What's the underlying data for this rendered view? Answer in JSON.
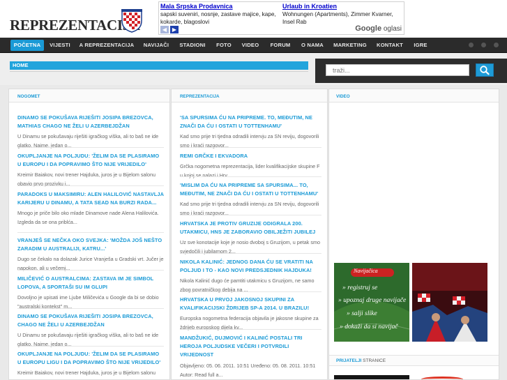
{
  "site": {
    "logo_text": "REPREZENTACIJA"
  },
  "ad": {
    "col1_title": "Mala Srpska Prodavnica",
    "col1_text": "sapski suveniri, nosnje, zastave majice, kape, kokarde, blagoslovi",
    "col2_title": "Urlaub in Kroatien",
    "col2_text": "Wohnungen (Apartments), Zimmer Kvarner, Insel Rab",
    "brand_google": "Google",
    "brand_oglasi": "oglasi"
  },
  "nav": {
    "items": [
      "POČETNA",
      "VIJESTI",
      "A REPREZENTACIJA",
      "NAVIJAČI",
      "STADIONI",
      "FOTO",
      "VIDEO",
      "FORUM",
      "O NAMA",
      "MARKETING",
      "KONTAKT",
      "IGRE"
    ],
    "active_index": 0
  },
  "breadcrumb": {
    "home": "HOME"
  },
  "search": {
    "placeholder": "traži..."
  },
  "columns": {
    "nogomet": {
      "title": "NOGOMET",
      "articles": [
        {
          "title": "DINAMO SE POKUŠAVA RIJEŠITI JOSIPA BREZOVCA, MATHIAS CHAGO NE ŽELI U AZERBEJDŽAN",
          "text": "U Dinamu se pokušavaju riješiti igračkog viška, ali to baš ne ide glatko. Naime, jedan o..."
        },
        {
          "title": "OKUPLJANJE NA POLJUDU: 'ŽELIM DA SE PLASIRAMO U EUROPU I DA POPRAVIMO ŠTO NIJE VRIJEDILO'",
          "text": "Kreimir Baiakov, novi trener Hajduka, juros je u Bijelom salonu obavio prvo prozivku i..."
        },
        {
          "title": "PARADOKS U MAKSIMIRU: ALEN HALILOVIĆ NASTAVLJA KARIJERU U DINAMU, A TATA SEAD NA BURZI RADA...",
          "text": "Mnogo je priče bilo oko mlade Dinamove nade Alena Halilovića. Izgleda da se ona priblća..."
        },
        {
          "title": "VRANJEŠ SE NEČKA OKO SVEJKA: 'MOŽDA JOŠ NEŠTO ZARADIM U AUSTRALIJI, KATRU...'",
          "text": "Dugo se čekalo na dolazak Jurice Vranješa u Gradski vrt. Jučer je napokon, ali u večemj..."
        },
        {
          "title": "MILIČEVIĆ O AUSTRALCIMA: ZASTAVA IM JE SIMBOL LOPOVA, A SPORTAŠI SU IM GLUPI",
          "text": "Dovoljno je upisati ime Ljube Miličevića u Google da bi se dobio \"australski kontekst\" m..."
        },
        {
          "title": "DINAMO SE POKUŠAVA RIJEŠITI JOSIPA BREZOVCA, CHAGO NE ŽELI U AZERBEJDŽAN",
          "text": "U Dinamu se pokušavaju riješiti igračkog viška, ali to baš ne ide glatko. Naime, jedan o..."
        },
        {
          "title": "OKUPLJANJE NA POLJUDU: 'ŽELIM DA SE PLASIRAMO U EUROPU LIGU I DA POPRAVIMO ŠTO NIJE VRIJEDILO'",
          "text": "Kreimir Baiakov, novi trener Hajduka, juros je u Bijelom salonu obavio prvo prozivku i..."
        }
      ]
    },
    "reprezentacija": {
      "title": "REPREZENTACIJA",
      "articles": [
        {
          "title": "'SA SPURSIMA ĆU NA PRIPREME. TO, MEĐUTIM, NE ZNAČI DA ĆU I OSTATI U TOTTENHAMU'",
          "text": "Kad smo prije tri tjedna odradili intervju za SN reviju, dogovorili smo i kraći razgovor..."
        },
        {
          "title": "REMI GRČKE I EKVADORA",
          "text": "Grčka nogometna reprezentacija, lider kvalifikacijske skupine F u kojoj se nalazi i Hrv..."
        },
        {
          "title": "'MISLIM DA ĆU NA PRIPREME SA SPURSIMA... TO, MEĐUTIM, NE ZNAČI DA ĆU I OSTATI U TOTTENHAMU'",
          "text": "Kad smo prije tri tjedna odradili intervju za SN reviju, dogovorili smo i kraći razgovor..."
        },
        {
          "title": "HRVATSKA JE PROTIV GRUZIJE ODIGRALA 200. UTAKMICU, HNS JE ZABORAVIO OBILJEŽITI JUBILEJ",
          "text": "Uz sve konotacije koje je nosio dvoboj s Gruzijom, u petak smo svjedočili i jubilarnom 2..."
        },
        {
          "title": "NIKOLA KALINIĆ: JEDNOG DANA ĆU SE VRATITI NA POLJUD I TO - KAO NOVI PREDSJEDNIK HAJDUKA!",
          "text": "Nikola Kalinić dugo će pamtiti utakmicu s Gruzijom, ne samo zbog povratničkog debija na ..."
        },
        {
          "title": "HRVATSKA U PRVOJ JAKOSNOJ SKUPINI ZA KVALIFIKACIJSKI ŽDRIJEB SP-A 2014. U BRAZILU!",
          "text": "Europska nogometna federacija objavila je jakosne skupine za ždrijeb europskog dijela kv..."
        },
        {
          "title": "MANDŽUKIĆ, DUJMOVIĆ I KALINIĆ POSTALI TRI HEROJA POLJUDSKE VEČERI I POTVRDILI VRIJEDNOST",
          "text": "Objavljeno: 05. 06. 2011. 10:51 Uređeno: 05. 08. 2011. 10:51 Autor: Read full a..."
        }
      ]
    },
    "video": {
      "title": "VIDEO",
      "promo_lines": [
        "Navijačica",
        "» registruj se",
        "» upoznaj druge navijače",
        "» salji slike",
        "» dokaži da si navijač"
      ],
      "friends_strong": "PRIJATELJI",
      "friends_rest": "STRANICE"
    }
  },
  "colors": {
    "accent": "#1a9ad6",
    "nav_bg": "#2b2b2b"
  }
}
